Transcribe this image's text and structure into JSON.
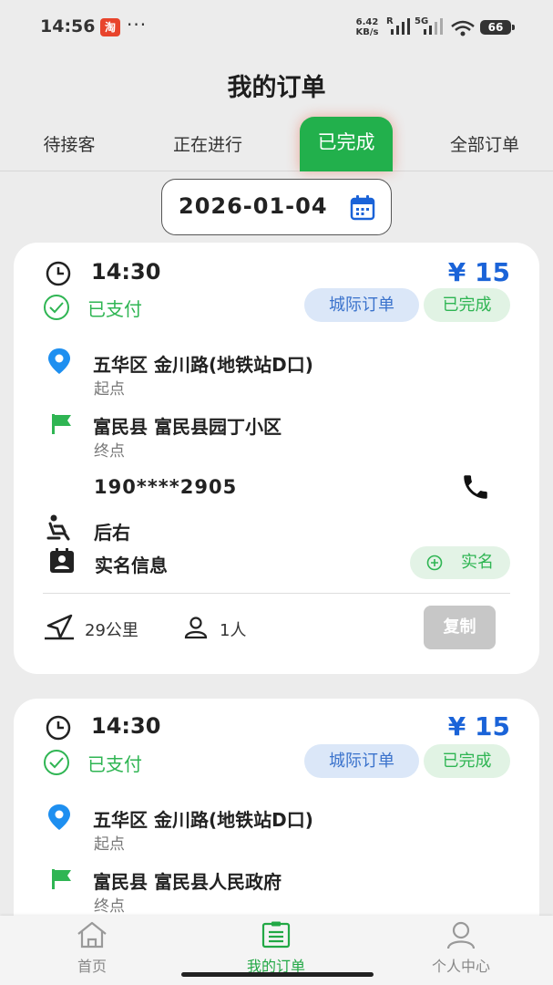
{
  "status_bar": {
    "time": "14:56",
    "app_badge": "淘",
    "more": "···",
    "net_speed_value": "6.42",
    "net_speed_unit": "KB/s",
    "network_label_r": "R",
    "network_label_5g": "5G",
    "battery": "66"
  },
  "header": {
    "title": "我的订单"
  },
  "tabs": [
    {
      "label": "待接客"
    },
    {
      "label": "正在进行"
    },
    {
      "label": "已完成"
    },
    {
      "label": "全部订单"
    }
  ],
  "active_tab": "已完成",
  "date_filter": {
    "value": "2026-01-04"
  },
  "orders": [
    {
      "time": "14:30",
      "price": "¥ 15",
      "payment_status": "已支付",
      "order_type": "城际订单",
      "order_status": "已完成",
      "start_address": "五华区 金川路(地铁站D口)",
      "start_label": "起点",
      "end_address": "富民县 富民县园丁小区",
      "end_label": "终点",
      "phone": "190****2905",
      "seat": "后右",
      "real_name_info": "实名信息",
      "real_name_button": "实名",
      "distance": "29公里",
      "passengers": "1人",
      "copy_button": "复制"
    },
    {
      "time": "14:30",
      "price": "¥ 15",
      "payment_status": "已支付",
      "order_type": "城际订单",
      "order_status": "已完成",
      "start_address": "五华区 金川路(地铁站D口)",
      "start_label": "起点",
      "end_address": "富民县 富民县人民政府",
      "end_label": "终点"
    }
  ],
  "bottom_nav": [
    {
      "label": "首页",
      "icon": "home-icon"
    },
    {
      "label": "我的订单",
      "icon": "order-list-icon"
    },
    {
      "label": "个人中心",
      "icon": "person-icon"
    }
  ],
  "colors": {
    "accent_green": "#22b04c",
    "price_blue": "#1a63d8",
    "tag_blue_bg": "#dbe7f8",
    "tag_green_bg": "#e1f3e4",
    "location_pin": "#1e8ff0"
  }
}
